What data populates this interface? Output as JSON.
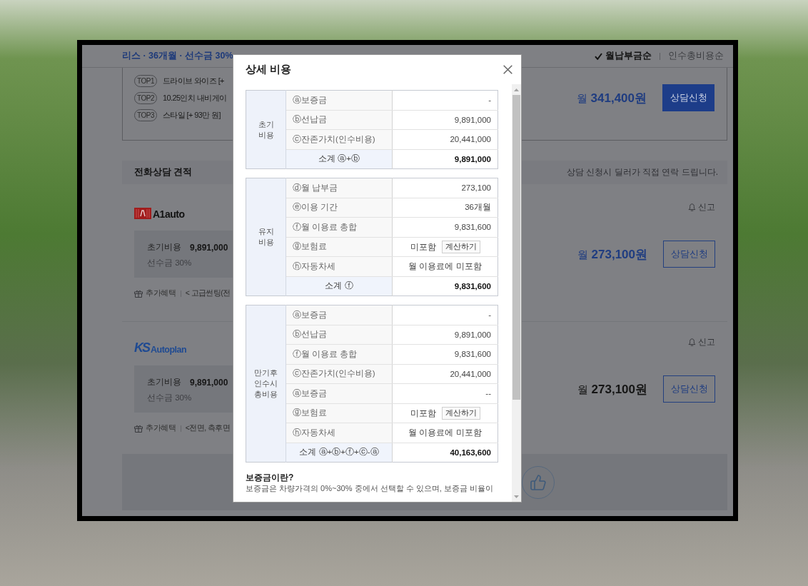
{
  "page": {
    "header": {
      "summary": "리스 · 36개월 · 선수금 30%",
      "sort_options": [
        {
          "label": "월납부금순",
          "selected": true
        },
        {
          "label": "인수총비용순",
          "selected": false
        }
      ]
    },
    "top_offer": {
      "options": [
        {
          "rank": "TOP1",
          "name": "드라이브 와이즈 [+"
        },
        {
          "rank": "TOP2",
          "name": "10.25인치 내비게이"
        },
        {
          "rank": "TOP3",
          "name": "스타일 [+ 93만 원]"
        }
      ],
      "price": "월 **341,400원**",
      "price_highlighted": true,
      "button": "상담신청"
    },
    "phone_quotes": {
      "title": "전화상담 견적",
      "notice": "상담 신청시 딜러가 직접 연락 드립니다.",
      "dealers": [
        {
          "logo": {
            "kind": "block",
            "text": "A1auto"
          },
          "report": "신고",
          "cost_label": "초기비용",
          "cost_value": "9,891,000",
          "deposit": "선수금 30%",
          "benefit_label": "추가혜택",
          "benefit": "< 고급썬팅(전",
          "price": "월 **273,100원**",
          "price_highlighted": true,
          "button": "상담신청"
        },
        {
          "logo": {
            "kind": "letters",
            "mark": "KS",
            "text": "Autoplan"
          },
          "report": "신고",
          "cost_label": "초기비용",
          "cost_value": "9,891,000",
          "deposit": "선수금 30%",
          "benefit_label": "추가혜택",
          "benefit": "<전면, 측후면",
          "price": "월 **273,100원**",
          "price_highlighted": false,
          "button": "상담신청"
        }
      ]
    }
  },
  "modal": {
    "title": "상세 비용",
    "sections": [
      {
        "group": "초기 비용",
        "rows": [
          {
            "kind": "amount",
            "label": "ⓐ보증금",
            "value": "-"
          },
          {
            "kind": "amount",
            "label": "ⓑ선납금",
            "value": "9,891,000"
          },
          {
            "kind": "amount",
            "label": "ⓒ잔존가치(인수비용)",
            "value": "20,441,000"
          }
        ],
        "subtotal": {
          "label": "소계 ⓐ+ⓑ",
          "value": "9,891,000"
        }
      },
      {
        "group": "유지 비용",
        "rows": [
          {
            "kind": "amount",
            "label": "ⓓ월 납부금",
            "value": "273,100"
          },
          {
            "kind": "amount",
            "label": "ⓔ이용 기간",
            "value": "36개월"
          },
          {
            "kind": "amount",
            "label": "ⓕ월 이용료 총합",
            "value": "9,831,600"
          },
          {
            "kind": "action",
            "label": "ⓖ보험료",
            "value": "미포함",
            "button": "계산하기"
          },
          {
            "kind": "note",
            "label": "ⓗ자동차세",
            "value": "월 이용료에 미포함"
          }
        ],
        "subtotal": {
          "label": "소계 ⓕ",
          "value": "9,831,600"
        }
      },
      {
        "group": "만기후 인수시 총비용",
        "rows": [
          {
            "kind": "amount",
            "label": "ⓐ보증금",
            "value": "-"
          },
          {
            "kind": "amount",
            "label": "ⓑ선납금",
            "value": "9,891,000"
          },
          {
            "kind": "amount",
            "label": "ⓕ월 이용료 총합",
            "value": "9,831,600"
          },
          {
            "kind": "amount",
            "label": "ⓒ잔존가치(인수비용)",
            "value": "20,441,000"
          },
          {
            "kind": "amount",
            "label": "ⓐ보증금",
            "value": "--"
          },
          {
            "kind": "action",
            "label": "ⓖ보험료",
            "value": "미포함",
            "button": "계산하기"
          },
          {
            "kind": "note",
            "label": "ⓗ자동차세",
            "value": "월 이용료에 미포함"
          }
        ],
        "subtotal": {
          "label": "소계 ⓐ+ⓑ+ⓕ+ⓒ-ⓐ",
          "value": "40,163,600"
        }
      }
    ],
    "note": {
      "title": "보증금이란?",
      "text": "보증금은 차량가격의 0%~30% 중에서 선택할 수 있으며, 보증금 비율이"
    }
  }
}
